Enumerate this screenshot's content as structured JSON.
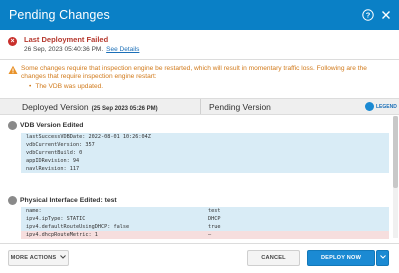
{
  "dialog": {
    "title": "Pending Changes",
    "accent_color": "#0a80c6",
    "help_icon": "question-circle-icon",
    "close_icon": "close-icon"
  },
  "error": {
    "icon": "error-x-icon",
    "title": "Last Deployment Failed",
    "date": "26 Sep, 2023 05:40:36 PM.",
    "link": "See Details"
  },
  "warning": {
    "icon": "warning-triangle-icon",
    "text": "Some changes require that inspection engine be restarted, which will result in momentary traffic loss. Following are the changes that require inspection engine restart:",
    "items": [
      "The VDB was updated."
    ]
  },
  "columns": {
    "deployed": "Deployed Version",
    "deployed_date": "(25 Sep 2023 05:26 PM)",
    "pending": "Pending Version",
    "legend": "LEGEND",
    "legend_icon": "info-icon"
  },
  "sections": [
    {
      "title": "VDB Version Edited",
      "rows": [
        {
          "deployed": "lastSuccessVDBDate: 2022-08-01 10:26:04Z",
          "pending": ""
        },
        {
          "deployed": "vdbCurrentVersion: 357",
          "pending": ""
        },
        {
          "deployed": "vdbCurrentBuild: 0",
          "pending": ""
        },
        {
          "deployed": "appIDRevision: 94",
          "pending": ""
        },
        {
          "deployed": "navlRevision: 117",
          "pending": ""
        }
      ]
    },
    {
      "title": "Physical Interface Edited: test",
      "rows": [
        {
          "deployed": "name:",
          "pending": "test"
        },
        {
          "deployed": "ipv4.ipType: STATIC",
          "pending": "DHCP"
        },
        {
          "deployed": "ipv4.defaultRouteUsingDHCP: false",
          "pending": "true"
        },
        {
          "deployed": "ipv4.dhcpRouteMetric: 1",
          "pending": "–"
        }
      ]
    }
  ],
  "footer": {
    "more_actions": "MORE ACTIONS",
    "cancel": "CANCEL",
    "deploy": "DEPLOY NOW"
  }
}
